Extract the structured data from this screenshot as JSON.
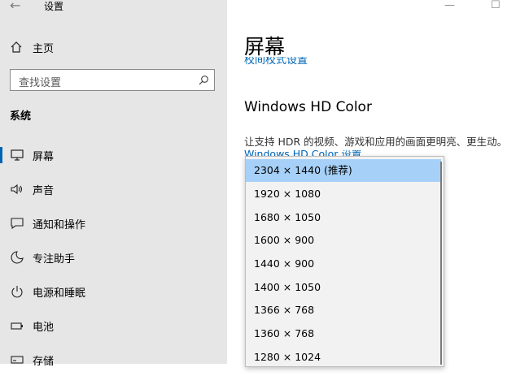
{
  "window": {
    "title": "设置",
    "minimize_glyph": "—",
    "maximize_glyph": "☐"
  },
  "sidebar": {
    "home_label": "主页",
    "search_placeholder": "查找设置",
    "section_header": "系统",
    "items": [
      {
        "label": "屏幕",
        "icon": "monitor-icon",
        "selected": true
      },
      {
        "label": "声音",
        "icon": "speaker-icon"
      },
      {
        "label": "通知和操作",
        "icon": "notification-icon"
      },
      {
        "label": "专注助手",
        "icon": "moon-icon"
      },
      {
        "label": "电源和睡眠",
        "icon": "power-icon"
      },
      {
        "label": "电池",
        "icon": "battery-icon"
      },
      {
        "label": "存储",
        "icon": "storage-icon"
      }
    ]
  },
  "main": {
    "page_title": "屏幕",
    "cut_link": "校间校式设置",
    "hd_heading": "Windows HD Color",
    "hd_description": "让支持 HDR 的视频、游戏和应用的画面更明亮、更生动。",
    "hd_link": "Windows HD Color 设置"
  },
  "resolution_dropdown": {
    "options": [
      "2304 × 1440 (推荐)",
      "1920 × 1080",
      "1680 × 1050",
      "1600 × 900",
      "1440 × 900",
      "1400 × 1050",
      "1366 × 768",
      "1360 × 768",
      "1280 × 1024"
    ],
    "selected_index": 0
  },
  "colors": {
    "accent": "#0063b1",
    "link": "#0067b8",
    "sidebar_bg": "#e6e6e6",
    "highlight": "#a6d0f7"
  }
}
